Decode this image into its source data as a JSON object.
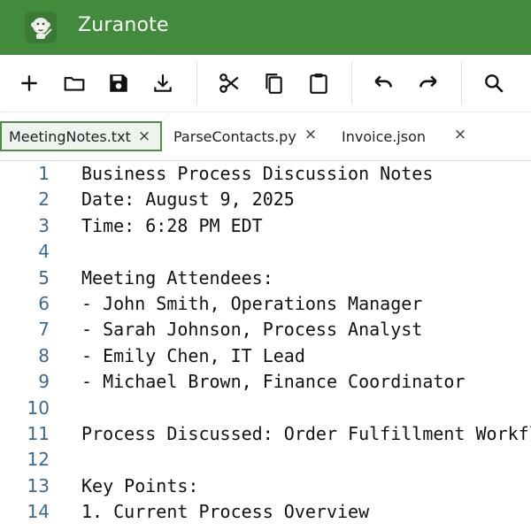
{
  "app": {
    "title": "Zuranote",
    "logo_icon": "monkey-logo-icon",
    "titlebar_color": "#428a3c",
    "accent_color": "#4a8f42"
  },
  "toolbar": {
    "buttons": [
      {
        "name": "new-file-button",
        "icon": "plus-icon"
      },
      {
        "name": "open-folder-button",
        "icon": "folder-icon"
      },
      {
        "name": "save-button",
        "icon": "floppy-disk-icon"
      },
      {
        "name": "download-button",
        "icon": "download-icon"
      },
      {
        "name": "cut-button",
        "icon": "scissors-icon"
      },
      {
        "name": "copy-button",
        "icon": "copy-icon"
      },
      {
        "name": "paste-button",
        "icon": "clipboard-icon"
      },
      {
        "name": "undo-button",
        "icon": "undo-icon"
      },
      {
        "name": "redo-button",
        "icon": "redo-icon"
      },
      {
        "name": "search-button",
        "icon": "search-icon"
      }
    ]
  },
  "tabs": [
    {
      "label": "MeetingNotes.txt",
      "active": true,
      "close_glyph": "×"
    },
    {
      "label": "ParseContacts.py",
      "active": false,
      "close_glyph": "×"
    },
    {
      "label": "Invoice.json",
      "active": false,
      "close_glyph": "×"
    }
  ],
  "editor": {
    "lines": [
      {
        "num": "1",
        "text": "Business Process Discussion Notes"
      },
      {
        "num": "2",
        "text": "Date: August 9, 2025"
      },
      {
        "num": "3",
        "text": "Time: 6:28 PM EDT"
      },
      {
        "num": "4",
        "text": ""
      },
      {
        "num": "5",
        "text": "Meeting Attendees:"
      },
      {
        "num": "6",
        "text": "- John Smith, Operations Manager"
      },
      {
        "num": "7",
        "text": "- Sarah Johnson, Process Analyst"
      },
      {
        "num": "8",
        "text": "- Emily Chen, IT Lead"
      },
      {
        "num": "9",
        "text": "- Michael Brown, Finance Coordinator"
      },
      {
        "num": "10",
        "text": ""
      },
      {
        "num": "11",
        "text": "Process Discussed: Order Fulfillment Workflow"
      },
      {
        "num": "12",
        "text": ""
      },
      {
        "num": "13",
        "text": "Key Points:"
      },
      {
        "num": "14",
        "text": "1. Current Process Overview"
      }
    ]
  }
}
